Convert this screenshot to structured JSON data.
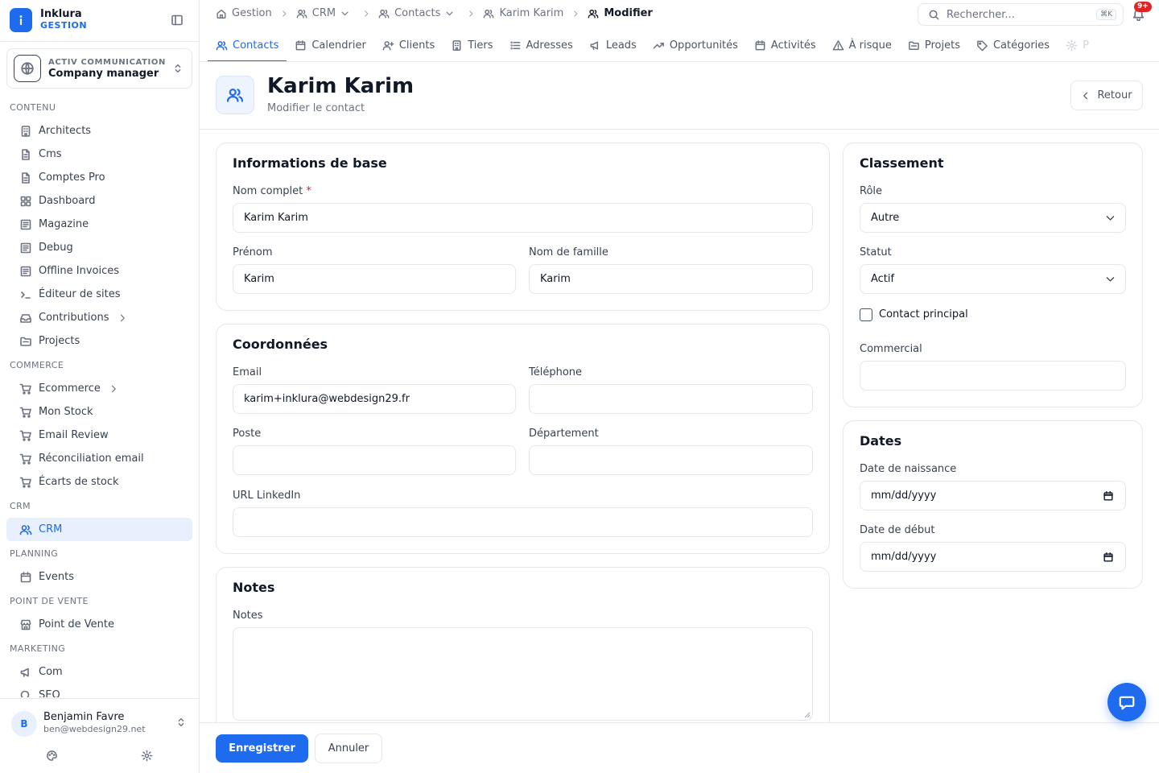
{
  "brand": {
    "name": "Inklura",
    "sub": "GESTION"
  },
  "company": {
    "org": "ACTIV COMMUNICATION",
    "role": "Company manager"
  },
  "sidebar": {
    "sections": [
      {
        "title": "CONTENU",
        "items": [
          {
            "label": "Architects",
            "icon": "building-icon"
          },
          {
            "label": "Cms",
            "icon": "document-icon"
          },
          {
            "label": "Comptes Pro",
            "icon": "document-icon"
          },
          {
            "label": "Dashboard",
            "icon": "grid-icon"
          },
          {
            "label": "Magazine",
            "icon": "newspaper-icon"
          },
          {
            "label": "Debug",
            "icon": "newspaper-icon"
          },
          {
            "label": "Offline Invoices",
            "icon": "newspaper-icon"
          },
          {
            "label": "Éditeur de sites",
            "icon": "terminal-icon"
          },
          {
            "label": "Contributions",
            "icon": "inbox-icon",
            "chevron": true
          },
          {
            "label": "Projects",
            "icon": "folder-icon"
          }
        ]
      },
      {
        "title": "COMMERCE",
        "items": [
          {
            "label": "Ecommerce",
            "icon": "cart-icon",
            "chevron": true
          },
          {
            "label": "Mon Stock",
            "icon": "cart-icon"
          },
          {
            "label": "Email Review",
            "icon": "cart-icon"
          },
          {
            "label": "Réconciliation email",
            "icon": "cart-icon"
          },
          {
            "label": "Écarts de stock",
            "icon": "cart-icon"
          }
        ]
      },
      {
        "title": "CRM",
        "items": [
          {
            "label": "CRM",
            "icon": "users-icon",
            "active": true
          }
        ]
      },
      {
        "title": "PLANNING",
        "items": [
          {
            "label": "Events",
            "icon": "calendar-icon"
          }
        ]
      },
      {
        "title": "POINT DE VENTE",
        "items": [
          {
            "label": "Point de Vente",
            "icon": "store-icon"
          }
        ]
      },
      {
        "title": "MARKETING",
        "items": [
          {
            "label": "Com",
            "icon": "megaphone-icon"
          },
          {
            "label": "SEO",
            "icon": "search-icon"
          }
        ]
      }
    ]
  },
  "user": {
    "initial": "B",
    "name": "Benjamin Favre",
    "email": "ben@webdesign29.net"
  },
  "breadcrumb": {
    "items": [
      {
        "label": "Gestion",
        "icon": "home-icon",
        "dropdown": false
      },
      {
        "label": "CRM",
        "icon": "users-icon",
        "dropdown": true
      },
      {
        "label": "Contacts",
        "icon": "users-icon",
        "dropdown": true
      },
      {
        "label": "Karim Karim",
        "icon": "users-icon",
        "dropdown": false
      }
    ],
    "current": "Modifier"
  },
  "search": {
    "placeholder": "Rechercher...",
    "shortcut": "⌘K"
  },
  "notifications": {
    "badge": "9+"
  },
  "tabs": [
    {
      "label": "Contacts",
      "icon": "users-icon",
      "active": true
    },
    {
      "label": "Calendrier",
      "icon": "calendar-icon"
    },
    {
      "label": "Clients",
      "icon": "user-plus-icon"
    },
    {
      "label": "Tiers",
      "icon": "building-icon"
    },
    {
      "label": "Adresses",
      "icon": "list-icon"
    },
    {
      "label": "Leads",
      "icon": "megaphone-icon"
    },
    {
      "label": "Opportunités",
      "icon": "trending-up-icon"
    },
    {
      "label": "Activités",
      "icon": "calendar-icon"
    },
    {
      "label": "À risque",
      "icon": "warning-icon"
    },
    {
      "label": "Projets",
      "icon": "folder-icon"
    },
    {
      "label": "Catégories",
      "icon": "tag-icon"
    },
    {
      "label": "P",
      "icon": "gear-icon",
      "faded": true
    }
  ],
  "page": {
    "title": "Karim Karim",
    "subtitle": "Modifier le contact",
    "back_label": "Retour"
  },
  "basic": {
    "title": "Informations de base",
    "fullname_label": "Nom complet",
    "required_mark": "*",
    "fullname_value": "Karim Karim",
    "firstname_label": "Prénom",
    "firstname_value": "Karim",
    "lastname_label": "Nom de famille",
    "lastname_value": "Karim"
  },
  "contact": {
    "title": "Coordonnées",
    "email_label": "Email",
    "email_value": "karim+inklura@webdesign29.fr",
    "phone_label": "Téléphone",
    "phone_value": "",
    "position_label": "Poste",
    "position_value": "",
    "department_label": "Département",
    "department_value": "",
    "linkedin_label": "URL LinkedIn",
    "linkedin_value": ""
  },
  "notes": {
    "title": "Notes",
    "label": "Notes",
    "value": ""
  },
  "classement": {
    "title": "Classement",
    "role_label": "Rôle",
    "role_value": "Autre",
    "status_label": "Statut",
    "status_value": "Actif",
    "primary_label": "Contact principal",
    "primary_checked": false,
    "commercial_label": "Commercial",
    "commercial_value": ""
  },
  "dates": {
    "title": "Dates",
    "birth_label": "Date de naissance",
    "birth_value": "mm/dd/yyyy",
    "start_label": "Date de début",
    "start_value": "mm/dd/yyyy"
  },
  "footer": {
    "save_label": "Enregistrer",
    "cancel_label": "Annuler"
  },
  "colors": {
    "accent": "#1e6bf0",
    "danger": "#dc2626",
    "border": "#e5e7eb"
  }
}
